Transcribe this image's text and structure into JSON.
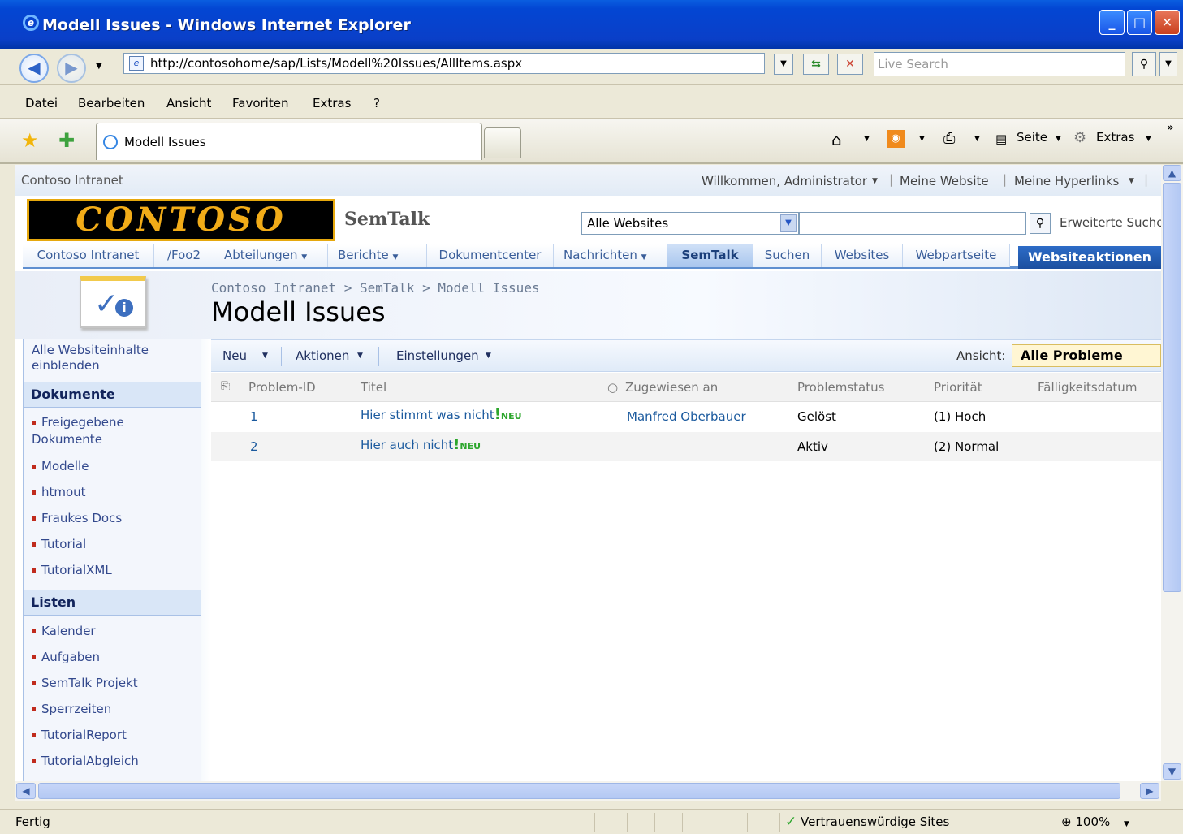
{
  "window": {
    "title": "Modell Issues - Windows Internet Explorer",
    "controls": [
      "_",
      "□",
      "✕"
    ]
  },
  "address": {
    "url": "http://contosohome/sap/Lists/Modell%20Issues/AllItems.aspx",
    "search_placeholder": "Live Search"
  },
  "menu": [
    "Datei",
    "Bearbeiten",
    "Ansicht",
    "Favoriten",
    "Extras",
    "?"
  ],
  "tab": {
    "label": "Modell Issues"
  },
  "toolbar_right": {
    "seite": "Seite",
    "extras": "Extras"
  },
  "site": {
    "top_left": "Contoso Intranet",
    "welcome": "Willkommen, Administrator",
    "my_site": "Meine Website",
    "my_links": "Meine Hyperlinks",
    "logo": "CONTOSO",
    "name": "SemTalk",
    "search_scope": "Alle Websites",
    "advanced_search": "Erweiterte Suche"
  },
  "topnav": [
    "Contoso Intranet",
    "/Foo2",
    "Abteilungen",
    "Berichte",
    "Dokumentcenter",
    "Nachrichten",
    "SemTalk",
    "Suchen",
    "Websites",
    "Webpartseite"
  ],
  "site_actions": "Websiteaktionen",
  "breadcrumb": "Contoso Intranet > SemTalk > Modell Issues",
  "page_title": "Modell Issues",
  "quicklaunch": {
    "view_all": "Alle Websiteinhalte einblenden",
    "documents_header": "Dokumente",
    "documents": [
      "Freigegebene Dokumente",
      "Modelle",
      "htmout",
      "Fraukes Docs",
      "Tutorial",
      "TutorialXML"
    ],
    "lists_header": "Listen",
    "lists": [
      "Kalender",
      "Aufgaben",
      "SemTalk Projekt",
      "Sperrzeiten",
      "TutorialReport",
      "TutorialAbgleich"
    ]
  },
  "list_toolbar": {
    "new": "Neu",
    "actions": "Aktionen",
    "settings": "Einstellungen",
    "view_label": "Ansicht:",
    "view_value": "Alle Probleme"
  },
  "columns": [
    "Problem-ID",
    "Titel",
    "Zugewiesen an",
    "Problemstatus",
    "Priorität",
    "Fälligkeitsdatum"
  ],
  "rows": [
    {
      "id": "1",
      "title": "Hier stimmt was nicht",
      "new_badge": "NEU",
      "assigned": "Manfred Oberbauer",
      "status": "Gelöst",
      "priority": "(1) Hoch",
      "due": ""
    },
    {
      "id": "2",
      "title": "Hier auch nicht",
      "new_badge": "NEU",
      "assigned": "",
      "status": "Aktiv",
      "priority": "(2) Normal",
      "due": ""
    }
  ],
  "statusbar": {
    "left": "Fertig",
    "zone": "Vertrauenswürdige Sites",
    "zoom": "100%"
  }
}
